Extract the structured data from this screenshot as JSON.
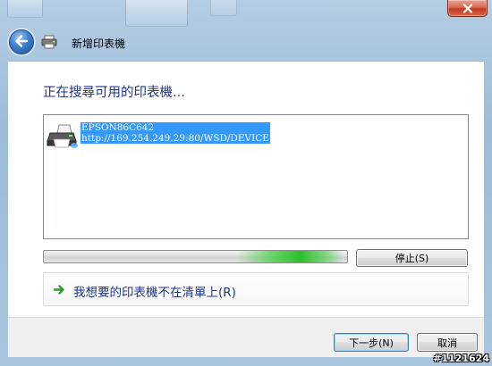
{
  "window": {
    "title": "新增印表機",
    "close_icon": "close-icon",
    "back_icon": "back-arrow-icon",
    "title_icon": "printer-icon"
  },
  "main": {
    "heading": "正在搜尋可用的印表機...",
    "printers": [
      {
        "name": "EPSON86C642",
        "address": "http://169.254.249.29:80/WSD/DEVICE",
        "icon": "printer-icon",
        "selected": true
      }
    ],
    "progress": {
      "indeterminate": true,
      "color": "#2cc02c"
    },
    "stop_button": "停止(S)",
    "link": {
      "text": "我想要的印表機不在清單上(R)",
      "icon": "green-arrow-icon",
      "color": "#1e3287"
    }
  },
  "footer": {
    "next_button": "下一步(N)",
    "cancel_button": "取消"
  },
  "watermark": "#1121624",
  "colors": {
    "heading": "#1e3287",
    "selection": "#3399ff"
  }
}
